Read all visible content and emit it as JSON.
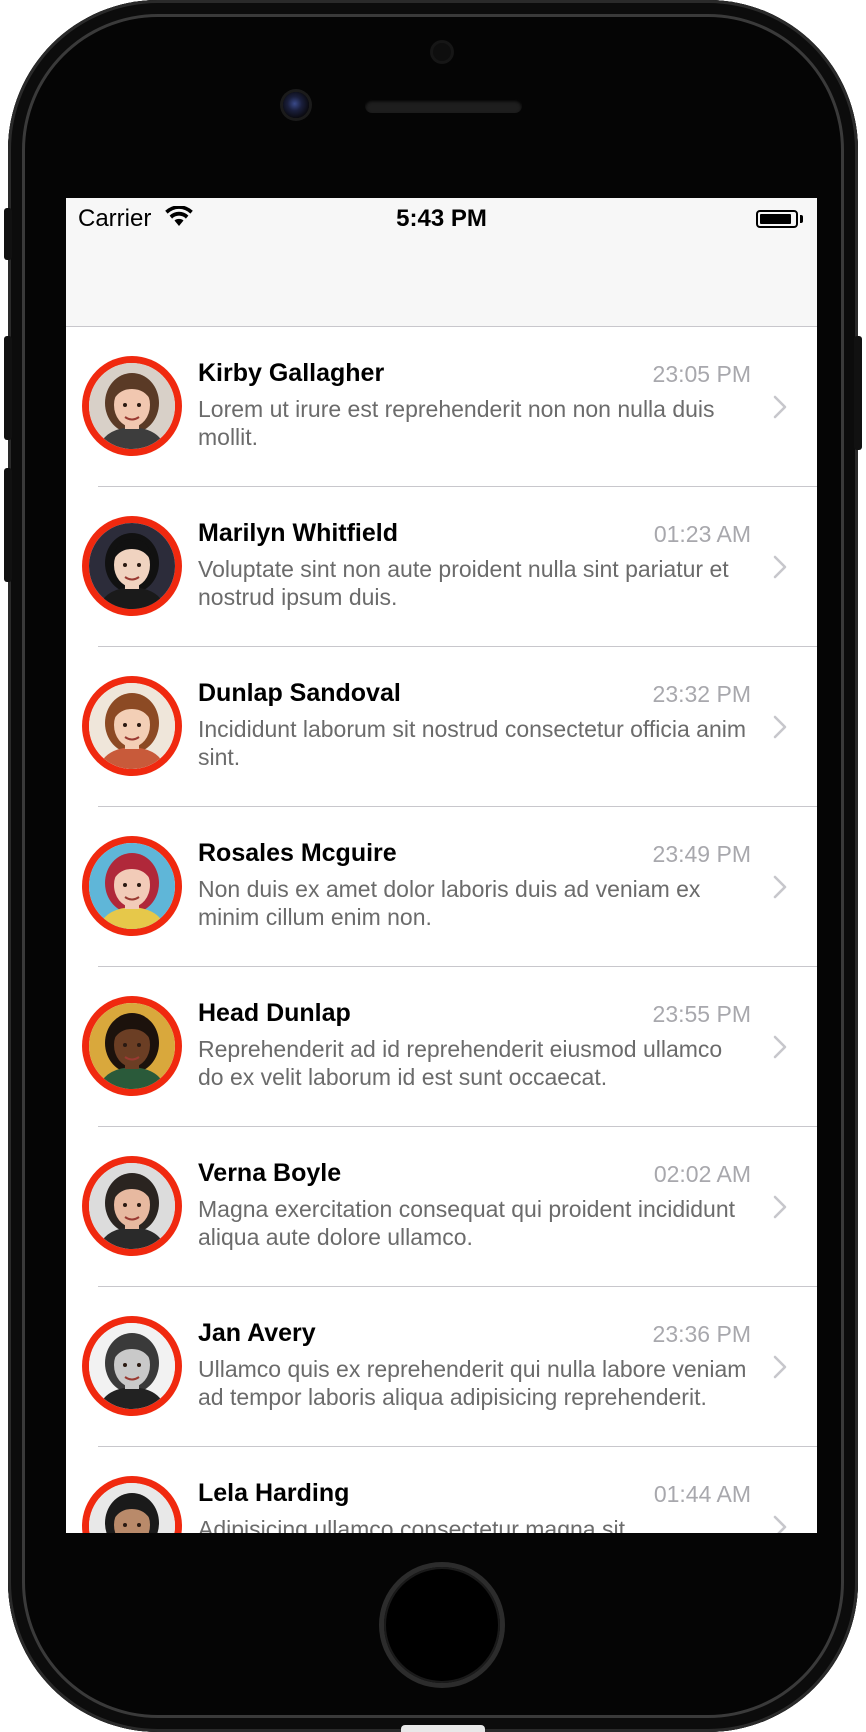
{
  "status_bar": {
    "carrier": "Carrier",
    "time": "5:43 PM",
    "battery_level": 0.9
  },
  "colors": {
    "avatar_ring": "#f0290f",
    "chevron": "#c7c7cc",
    "timestamp": "#a8a8ad"
  },
  "contacts": [
    {
      "name": "Kirby Gallagher",
      "time": "23:05 PM",
      "message": "Lorem ut irure est reprehenderit non non nulla duis mollit.",
      "avatar": {
        "skin": "#f1c7b0",
        "hair": "#5a3a26",
        "bg": "#d8d0c8",
        "shirt": "#3d3d3d"
      }
    },
    {
      "name": "Marilyn Whitfield",
      "time": "01:23 AM",
      "message": "Voluptate sint non aute proident nulla sint pariatur et nostrud ipsum duis.",
      "avatar": {
        "skin": "#f0d3c0",
        "hair": "#111111",
        "bg": "#2c2c3a",
        "shirt": "#1a1a1a"
      }
    },
    {
      "name": "Dunlap Sandoval",
      "time": "23:32 PM",
      "message": "Incididunt laborum sit nostrud consectetur officia anim sint.",
      "avatar": {
        "skin": "#f3cfb6",
        "hair": "#8c4a24",
        "bg": "#efe6da",
        "shirt": "#c85a3a"
      }
    },
    {
      "name": "Rosales Mcguire",
      "time": "23:49 PM",
      "message": "Non duis ex amet dolor laboris duis ad veniam ex minim cillum enim non.",
      "avatar": {
        "skin": "#f2cbb8",
        "hair": "#b0283a",
        "bg": "#5fb6d8",
        "shirt": "#e6c84a"
      }
    },
    {
      "name": "Head Dunlap",
      "time": "23:55 PM",
      "message": "Reprehenderit ad id reprehenderit eiusmod ullamco do ex velit laborum id est sunt occaecat.",
      "avatar": {
        "skin": "#6b3e24",
        "hair": "#1c120c",
        "bg": "#d9a83c",
        "shirt": "#2a5a3a"
      }
    },
    {
      "name": "Verna Boyle",
      "time": "02:02 AM",
      "message": "Magna exercitation consequat qui proident incididunt aliqua aute dolore ullamco.",
      "avatar": {
        "skin": "#e7b9a0",
        "hair": "#2a2420",
        "bg": "#dcdcdc",
        "shirt": "#2a2a2a"
      }
    },
    {
      "name": "Jan Avery",
      "time": "23:36 PM",
      "message": "Ullamco quis ex reprehenderit qui nulla labore veniam ad tempor laboris aliqua adipisicing reprehenderit.",
      "avatar": {
        "skin": "#c9c9c9",
        "hair": "#3a3a3a",
        "bg": "#f2f2f2",
        "shirt": "#222222"
      }
    },
    {
      "name": "Lela Harding",
      "time": "01:44 AM",
      "message": "Adipisicing ullamco consectetur magna sit",
      "avatar": {
        "skin": "#b98a6a",
        "hair": "#1a1a1a",
        "bg": "#e8e8e8",
        "shirt": "#2a2a2a"
      }
    }
  ]
}
